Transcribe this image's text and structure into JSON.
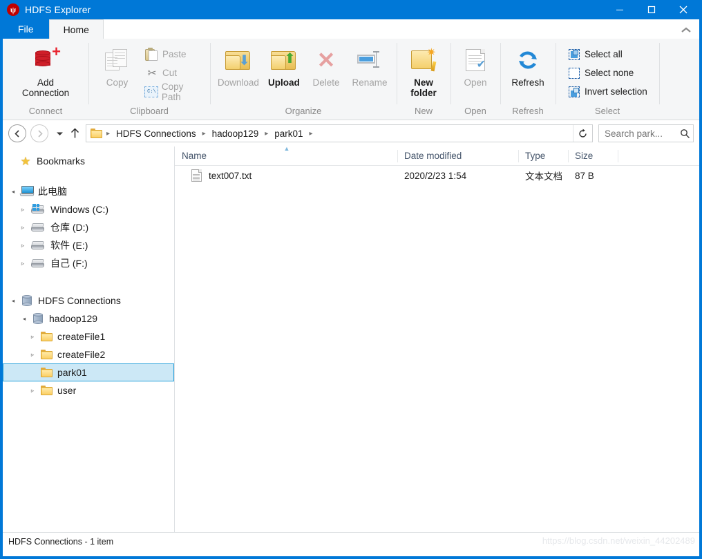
{
  "window": {
    "title": "HDFS Explorer",
    "app_icon": "hdfs-logo-icon",
    "minimize_label": "─",
    "maximize_label": "☐",
    "close_label": "✕"
  },
  "tabs": [
    {
      "label": "File",
      "active": false
    },
    {
      "label": "Home",
      "active": true
    }
  ],
  "ribbon": {
    "collapse_icon": "chevron-up-icon",
    "groups": [
      {
        "name": "Connect",
        "label": "Connect",
        "buttons": [
          {
            "label": "Add\nConnection",
            "line1": "Add",
            "line2": "Connection",
            "icon": "add-connection-icon",
            "disabled": false
          }
        ]
      },
      {
        "name": "Clipboard",
        "label": "Clipboard",
        "big": {
          "label": "Copy",
          "icon": "copy-icon",
          "disabled": true
        },
        "small": [
          {
            "label": "Paste",
            "icon": "paste-icon",
            "disabled": true
          },
          {
            "label": "Cut",
            "icon": "cut-icon",
            "disabled": true
          },
          {
            "label": "Copy Path",
            "icon": "copy-path-icon",
            "disabled": true
          }
        ]
      },
      {
        "name": "Organize",
        "label": "Organize",
        "buttons": [
          {
            "label": "Download",
            "icon": "download-folder-icon",
            "disabled": true
          },
          {
            "label": "Upload",
            "icon": "upload-folder-icon",
            "disabled": false
          },
          {
            "label": "Delete",
            "icon": "delete-x-icon",
            "disabled": true
          },
          {
            "label": "Rename",
            "icon": "rename-icon",
            "disabled": true
          }
        ]
      },
      {
        "name": "New",
        "label": "New",
        "buttons": [
          {
            "label": "New\nfolder",
            "line1": "New",
            "line2": "folder",
            "icon": "new-folder-icon",
            "disabled": false
          }
        ]
      },
      {
        "name": "Open",
        "label": "Open",
        "buttons": [
          {
            "label": "Open",
            "icon": "open-document-icon",
            "disabled": true
          }
        ]
      },
      {
        "name": "Refresh",
        "label": "Refresh",
        "buttons": [
          {
            "label": "Refresh",
            "icon": "refresh-icon",
            "disabled": false
          }
        ]
      },
      {
        "name": "Select",
        "label": "Select",
        "small": [
          {
            "label": "Select all",
            "icon": "select-all-icon",
            "disabled": false
          },
          {
            "label": "Select none",
            "icon": "select-none-icon",
            "disabled": false
          },
          {
            "label": "Invert selection",
            "icon": "invert-selection-icon",
            "disabled": false
          }
        ]
      }
    ]
  },
  "addressbar": {
    "back_icon": "arrow-left-icon",
    "forward_icon": "arrow-right-icon",
    "history_icon": "chevron-down-icon",
    "up_icon": "arrow-up-icon",
    "refresh_icon": "refresh-arrow-icon",
    "folder_icon": "folder-icon",
    "breadcrumbs": [
      "HDFS Connections",
      "hadoop129",
      "park01"
    ],
    "separator": "▸",
    "search": {
      "placeholder": "Search park...",
      "value": "",
      "icon": "search-icon"
    }
  },
  "sidebar": {
    "bookmarks": {
      "label": "Bookmarks",
      "icon": "star-icon"
    },
    "this_pc": {
      "label": "此电脑",
      "icon": "monitor-icon",
      "expander": "◂",
      "children": [
        {
          "label": "Windows (C:)",
          "icon": "windows-drive-icon",
          "expander": "▹"
        },
        {
          "label": "仓库 (D:)",
          "icon": "drive-icon",
          "expander": "▹"
        },
        {
          "label": "软件 (E:)",
          "icon": "drive-icon",
          "expander": "▹"
        },
        {
          "label": "自己 (F:)",
          "icon": "drive-icon",
          "expander": "▹"
        }
      ]
    },
    "hdfs": {
      "label": "HDFS Connections",
      "icon": "database-icon",
      "expander": "◂",
      "connection": {
        "label": "hadoop129",
        "icon": "database-icon",
        "expander": "◂",
        "children": [
          {
            "label": "createFile1",
            "icon": "folder-icon",
            "expander": "▹",
            "selected": false
          },
          {
            "label": "createFile2",
            "icon": "folder-icon",
            "expander": "▹",
            "selected": false
          },
          {
            "label": "park01",
            "icon": "folder-icon",
            "expander": "",
            "selected": true
          },
          {
            "label": "user",
            "icon": "folder-icon",
            "expander": "▹",
            "selected": false
          }
        ]
      }
    }
  },
  "filelist": {
    "columns": [
      {
        "key": "name",
        "label": "Name",
        "sorted": "asc",
        "sort_icon": "sort-ascending-icon"
      },
      {
        "key": "date",
        "label": "Date modified",
        "sorted": ""
      },
      {
        "key": "type",
        "label": "Type",
        "sorted": ""
      },
      {
        "key": "size",
        "label": "Size",
        "sorted": ""
      }
    ],
    "rows": [
      {
        "name": "text007.txt",
        "date": "2020/2/23 1:54",
        "type": "文本文档",
        "size": "87 B",
        "icon": "text-file-icon"
      }
    ]
  },
  "statusbar": {
    "text": "HDFS Connections - 1 item",
    "watermark": "https://blog.csdn.net/weixin_44202489"
  },
  "colors": {
    "title_bar": "#0078d7",
    "ribbon_bg": "#f5f6f7",
    "selection_bg": "#cce8f6",
    "selection_border": "#26a0da",
    "column_header_text": "#44546a"
  }
}
